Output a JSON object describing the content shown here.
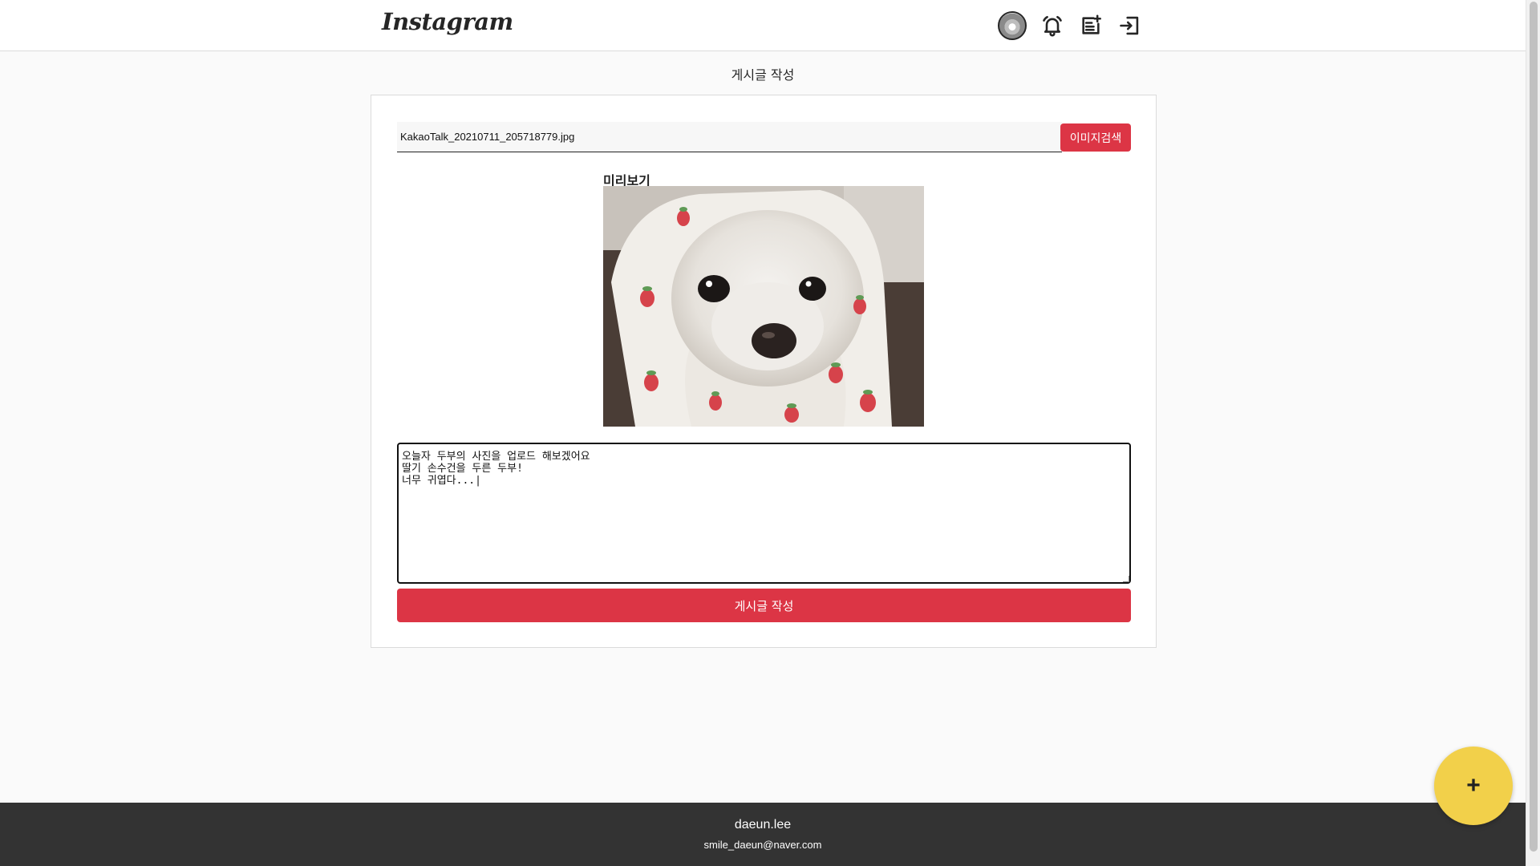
{
  "header": {
    "logo": "Instagram",
    "icons": [
      "profile-avatar",
      "bell-icon",
      "new-post-icon",
      "logout-icon"
    ]
  },
  "page": {
    "title": "게시글 작성"
  },
  "form": {
    "file_name": "KakaoTalk_20210711_205718779.jpg",
    "search_button": "이미지검색",
    "preview_label": "미리보기",
    "content": "오늘자 두부의 사진을 업로드 해보겠어요\n딸기 손수건을 두른 두부!\n너무 귀엽다...|",
    "submit_button": "게시글 작성"
  },
  "footer": {
    "name": "daeun.lee",
    "email": "smile_daeun@naver.com"
  },
  "fab": {
    "label": "+"
  },
  "colors": {
    "primary": "#dc3545",
    "fab": "#f2d04a",
    "footer_bg": "#333333",
    "page_bg": "#fafafa"
  }
}
